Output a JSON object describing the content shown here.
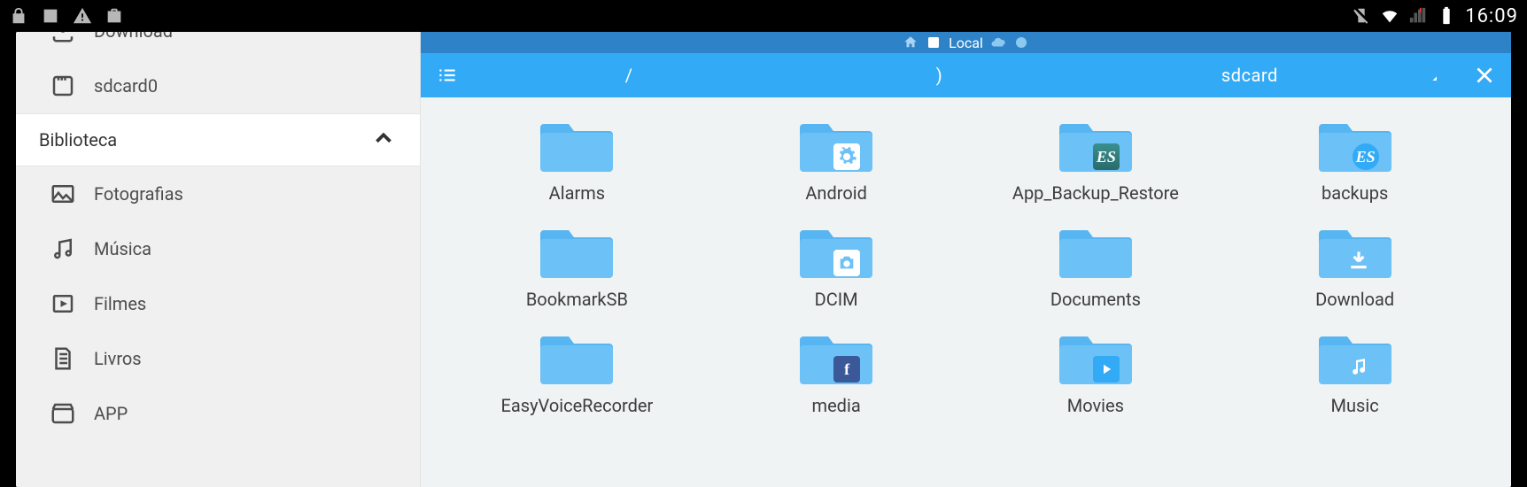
{
  "statusbar": {
    "time": "16:09"
  },
  "sidebar": {
    "download": "Download",
    "sdcard0": "sdcard0",
    "biblioteca": "Biblioteca",
    "fotografias": "Fotografias",
    "musica": "Música",
    "filmes": "Filmes",
    "livros": "Livros",
    "app": "APP"
  },
  "location": {
    "label": "Local"
  },
  "breadcrumb": {
    "root": "/",
    "sep": ")",
    "current": "sdcard"
  },
  "folders": [
    {
      "name": "Alarms",
      "overlay": "none"
    },
    {
      "name": "Android",
      "overlay": "settings"
    },
    {
      "name": "App_Backup_Restore",
      "overlay": "es"
    },
    {
      "name": "backups",
      "overlay": "esb"
    },
    {
      "name": "BookmarkSB",
      "overlay": "none"
    },
    {
      "name": "DCIM",
      "overlay": "cam"
    },
    {
      "name": "Documents",
      "overlay": "none"
    },
    {
      "name": "Download",
      "overlay": "dl"
    },
    {
      "name": "EasyVoiceRecorder",
      "overlay": "none"
    },
    {
      "name": "media",
      "overlay": "fb"
    },
    {
      "name": "Movies",
      "overlay": "play"
    },
    {
      "name": "Music",
      "overlay": "music"
    }
  ]
}
